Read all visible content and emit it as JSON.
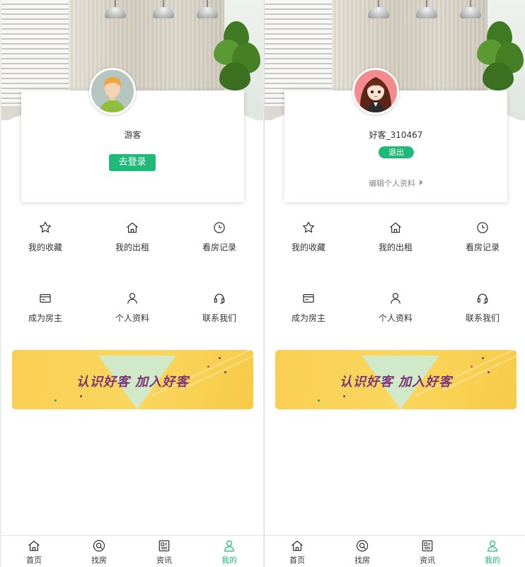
{
  "screens": [
    {
      "state": "logged-out",
      "username": "游客",
      "login_button": "去登录"
    },
    {
      "state": "logged-in",
      "username": "好客_310467",
      "logout_button": "退出",
      "edit_profile": "编辑个人资料"
    }
  ],
  "menu": [
    {
      "label": "我的收藏",
      "icon": "star-icon"
    },
    {
      "label": "我的出租",
      "icon": "house-icon"
    },
    {
      "label": "看房记录",
      "icon": "clock-icon"
    },
    {
      "label": "成为房主",
      "icon": "card-icon"
    },
    {
      "label": "个人资料",
      "icon": "person-icon"
    },
    {
      "label": "联系我们",
      "icon": "headset-icon"
    }
  ],
  "promo": {
    "text": "认识好客 加入好客"
  },
  "tabs": [
    {
      "label": "首页",
      "icon": "home-icon",
      "active": false
    },
    {
      "label": "找房",
      "icon": "search-icon",
      "active": false
    },
    {
      "label": "资讯",
      "icon": "news-icon",
      "active": false
    },
    {
      "label": "我的",
      "icon": "profile-icon",
      "active": true
    }
  ],
  "colors": {
    "accent": "#1fb97a",
    "promo_yellow": "#fbd75e",
    "promo_text": "#7b3576"
  }
}
